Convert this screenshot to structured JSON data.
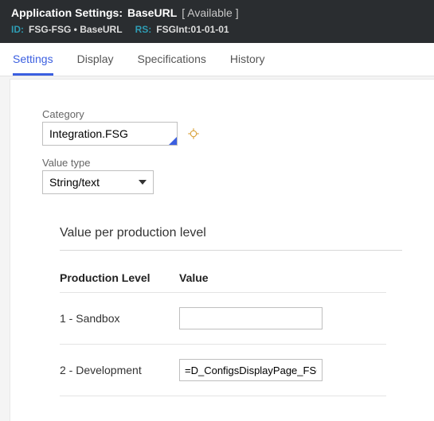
{
  "header": {
    "title_prefix": "Application Settings:",
    "title_name": "BaseURL",
    "status": "[ Available ]",
    "id_label": "ID:",
    "id_value": "FSG-FSG • BaseURL",
    "rs_label": "RS:",
    "rs_value": "FSGInt:01-01-01"
  },
  "tabs": {
    "settings": "Settings",
    "display": "Display",
    "specifications": "Specifications",
    "history": "History"
  },
  "form": {
    "category_label": "Category",
    "category_value": "Integration.FSG",
    "valuetype_label": "Value type",
    "valuetype_value": "String/text"
  },
  "section": {
    "title": "Value per production level",
    "col_level": "Production Level",
    "col_value": "Value",
    "rows": [
      {
        "level": "1 - Sandbox",
        "value": ""
      },
      {
        "level": "2 - Development",
        "value": "=D_ConfigsDisplayPage_FSGC"
      }
    ]
  }
}
